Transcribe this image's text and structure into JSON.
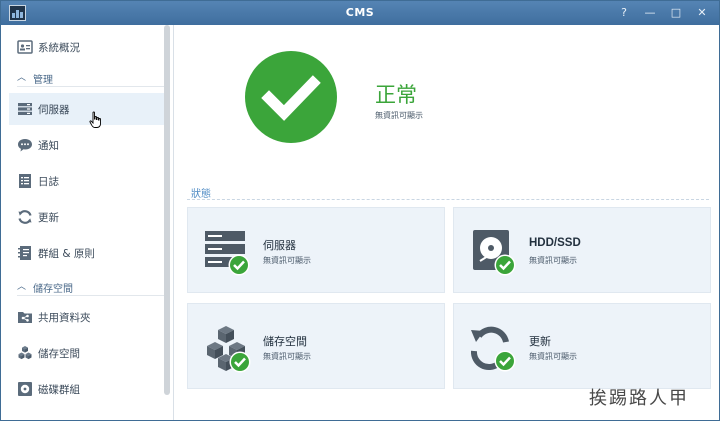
{
  "window": {
    "title": "CMS",
    "buttons": [
      "?",
      "—",
      "□",
      "✕"
    ]
  },
  "sidebar": {
    "items_top": [
      {
        "label": "系統概況",
        "icon": "system-overview-icon"
      }
    ],
    "section_management": {
      "label": "管理",
      "expanded": true
    },
    "management_items": [
      {
        "label": "伺服器",
        "icon": "server-icon",
        "selected": true
      },
      {
        "label": "通知",
        "icon": "notification-icon"
      },
      {
        "label": "日誌",
        "icon": "log-icon"
      },
      {
        "label": "更新",
        "icon": "update-icon"
      },
      {
        "label": "群組 & 原則",
        "icon": "group-policy-icon"
      }
    ],
    "section_storage": {
      "label": "儲存空間",
      "expanded": true
    },
    "storage_items": [
      {
        "label": "共用資料夾",
        "icon": "shared-folder-icon"
      },
      {
        "label": "儲存空間",
        "icon": "storage-icon"
      },
      {
        "label": "磁碟群組",
        "icon": "disk-group-icon"
      }
    ]
  },
  "main": {
    "status": {
      "text": "正常",
      "sub": "無資訊可顯示",
      "color": "#3ba53a"
    },
    "section_title": "狀態",
    "cards": [
      {
        "title": "伺服器",
        "sub": "無資訊可顯示",
        "icon": "server-icon"
      },
      {
        "title": "HDD/SSD",
        "sub": "無資訊可顯示",
        "icon": "hdd-icon"
      },
      {
        "title": "儲存空間",
        "sub": "無資訊可顯示",
        "icon": "storage-cubes-icon"
      },
      {
        "title": "更新",
        "sub": "無資訊可顯示",
        "icon": "update-icon"
      }
    ]
  },
  "watermark": "挨踢路人甲",
  "colors": {
    "titlebar": "#4a78a8",
    "accent": "#4f8bc4",
    "ok": "#3ba53a",
    "card": "#edf3f9"
  }
}
